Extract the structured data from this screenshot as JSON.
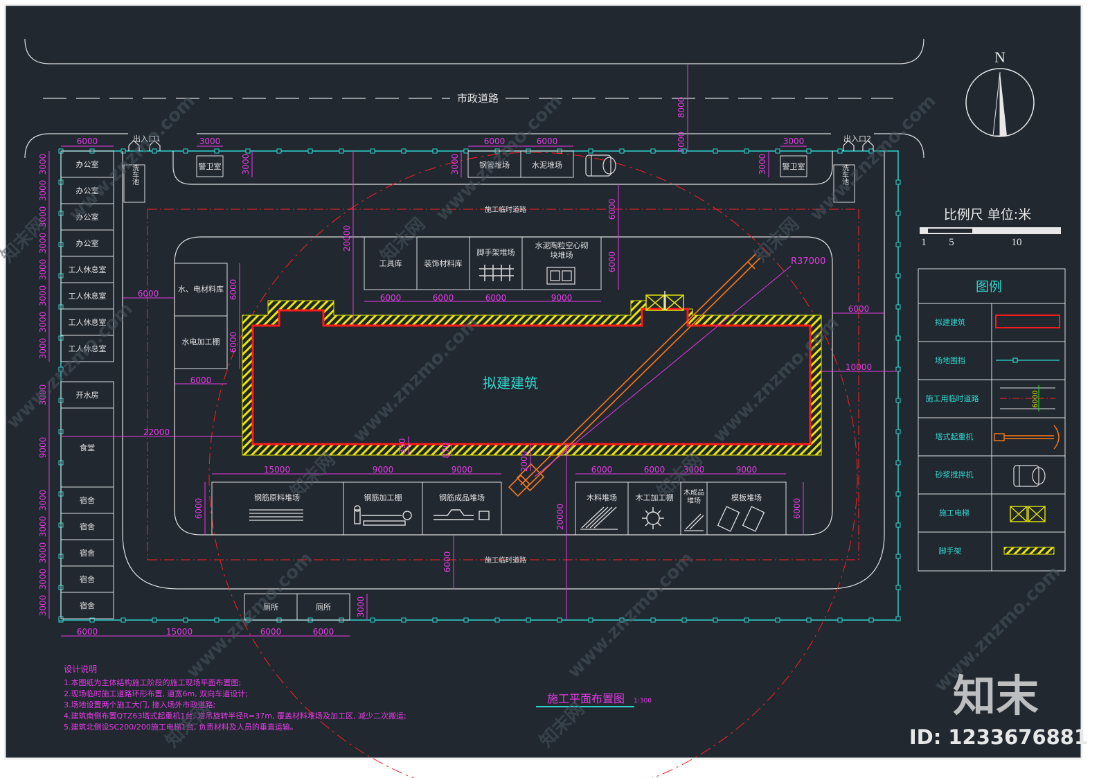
{
  "road": {
    "label": "市政道路"
  },
  "gates": {
    "entry1": "出入口1",
    "entry2": "出入口2"
  },
  "guard_room": "警卫室",
  "wash_pit": "洗车池",
  "left_buildings": [
    "办公室",
    "办公室",
    "办公室",
    "办公室",
    "工人休息室",
    "工人休息室",
    "工人休息室",
    "工人休息室"
  ],
  "water_room": "开水房",
  "canteen": "食堂",
  "dorms": [
    "宿舍",
    "宿舍",
    "宿舍",
    "宿舍",
    "宿舍"
  ],
  "toilets": [
    "厕所",
    "厕所"
  ],
  "top_yards": {
    "steel_pipe": "钢管堆场",
    "cement": "水泥堆场"
  },
  "store_row": {
    "tools": "工具库",
    "decor": "装饰材料库",
    "scaffold": "脚手架堆场",
    "cement_block": "水泥陶粒空心砌块堆场"
  },
  "left_sheds": {
    "material": "水、电材料库",
    "processing": "水电加工棚"
  },
  "building": {
    "label": "拟建建筑"
  },
  "temp_road": "施工临时道路",
  "bottom_yards": {
    "rebar_raw": "钢筋原料堆场",
    "rebar_proc": "钢筋加工棚",
    "rebar_done": "钢筋成品堆场",
    "wood": "木料堆场",
    "wood_proc": "木工加工棚",
    "wood_done": "木成品堆场",
    "formwork": "模板堆场"
  },
  "crane_radius": "R37000",
  "dimensions": {
    "d6000": "6000",
    "d3000": "3000",
    "d9000": "9000",
    "d15000": "15000",
    "d20000": "20000",
    "d22000": "22000",
    "d10000": "10000",
    "d8000": "8000",
    "d2000": "2000",
    "d350": "350",
    "d870": "870"
  },
  "compass": {
    "north": "N"
  },
  "scale": {
    "title": "比例尺  单位:米",
    "t1": "1",
    "t5": "5",
    "t10": "10"
  },
  "legend": {
    "title": "图例",
    "items": [
      "拟建建筑",
      "场地围挡",
      "施工用临时道路",
      "塔式起重机",
      "砂浆搅拌机",
      "施工电梯",
      "脚手架"
    ],
    "road_dim": "6000"
  },
  "notes": {
    "title": "设计说明",
    "lines": [
      "1.本图纸为主体结构施工阶段的施工现场平面布置图;",
      "2.现场临时施工道路环形布置, 道宽6m, 双向车道设计;",
      "3.场地设置两个施工大门, 接入场外市政道路;",
      "4.建筑南侧布置QTZ63塔式起重机1台, 塔吊旋转半径R=37m, 覆盖材料堆场及加工区, 减少二次搬运;",
      "5.建筑北侧设SC200/200施工电梯1台, 负责材料及人员的垂直运输。"
    ]
  },
  "drawing_title": {
    "title": "施工平面布置图",
    "scale": "1:300"
  },
  "watermark": {
    "site": "www.znzmo.com",
    "cn": "知末网",
    "logo": "知末",
    "id": "ID: 1233676881"
  },
  "colors": {
    "background": "#212830",
    "lines": "#e8e8e8",
    "fence": "#2fd6cf",
    "dimension": "#e63be6",
    "building": "#ff1a1a",
    "scaffold": "#e6e600",
    "crane": "#ff7a1a"
  }
}
